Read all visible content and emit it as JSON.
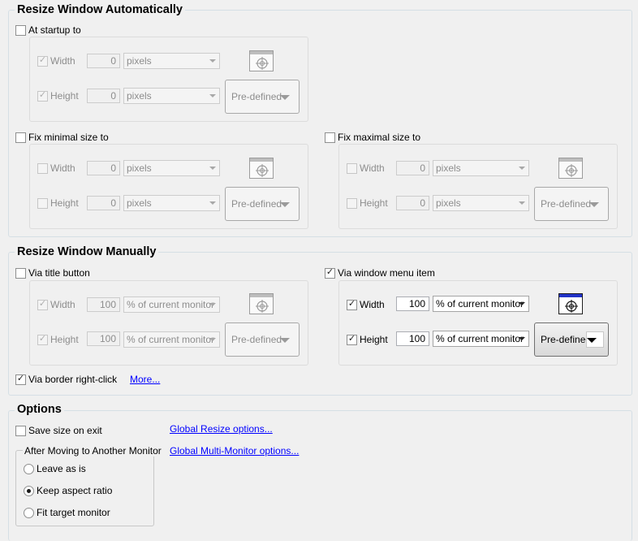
{
  "auto": {
    "title": "Resize Window Automatically",
    "at_startup": {
      "label": "At startup to",
      "checked": false,
      "width": {
        "label": "Width",
        "value": "0",
        "unit": "pixels"
      },
      "height": {
        "label": "Height",
        "value": "0",
        "unit": "pixels"
      },
      "predefined": "Pre-defined"
    },
    "fix_min": {
      "label": "Fix minimal size to",
      "checked": false,
      "width": {
        "label": "Width",
        "value": "0",
        "unit": "pixels"
      },
      "height": {
        "label": "Height",
        "value": "0",
        "unit": "pixels"
      },
      "predefined": "Pre-defined"
    },
    "fix_max": {
      "label": "Fix maximal size to",
      "checked": false,
      "width": {
        "label": "Width",
        "value": "0",
        "unit": "pixels"
      },
      "height": {
        "label": "Height",
        "value": "0",
        "unit": "pixels"
      },
      "predefined": "Pre-defined"
    }
  },
  "manual": {
    "title": "Resize Window Manually",
    "title_button": {
      "label": "Via title button",
      "checked": false,
      "width": {
        "label": "Width",
        "value": "100",
        "unit": "% of current monitor"
      },
      "height": {
        "label": "Height",
        "value": "100",
        "unit": "% of current monitor"
      },
      "predefined": "Pre-defined"
    },
    "menu_item": {
      "label": "Via window menu item",
      "checked": true,
      "width": {
        "label": "Width",
        "value": "100",
        "unit": "% of current monitor"
      },
      "height": {
        "label": "Height",
        "value": "100",
        "unit": "% of current monitor"
      },
      "predefined": "Pre-defined"
    },
    "border": {
      "label": "Via border right-click",
      "checked": true
    },
    "more_link": "More..."
  },
  "options": {
    "title": "Options",
    "save_on_exit": "Save size on exit",
    "global_resize_link": "Global Resize options...",
    "global_multi_link": "Global Multi-Monitor options...",
    "monitor_group": {
      "title": "After Moving to Another Monitor",
      "leave": "Leave as is",
      "keep": "Keep aspect ratio",
      "fit": "Fit target monitor",
      "selected": "keep"
    }
  },
  "icons": {
    "check": "✓",
    "window_icon": "window-crosshair-icon"
  }
}
